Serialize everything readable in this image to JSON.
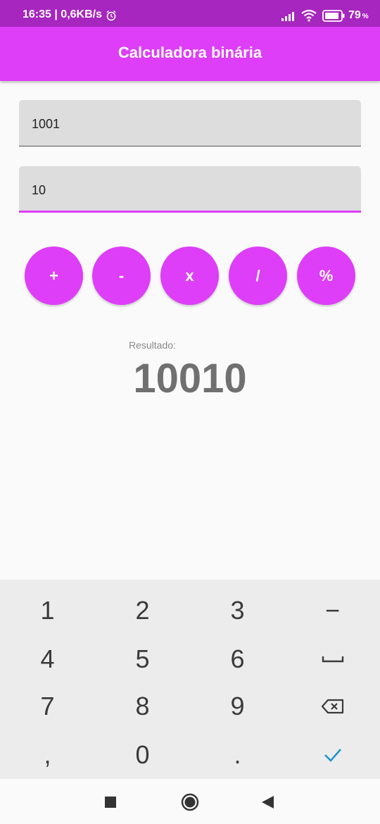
{
  "status_bar": {
    "time": "16:35 | 0,6KB/s",
    "battery_percent": "79",
    "battery_unit": "%",
    "icons": [
      "alarm-icon",
      "signal-icon",
      "wifi-icon",
      "battery-icon"
    ]
  },
  "app_bar": {
    "title": "Calculadora binária"
  },
  "inputs": {
    "first": {
      "value": "1001"
    },
    "second": {
      "value": "10"
    }
  },
  "operators": [
    "+",
    "-",
    "x",
    "/",
    "%"
  ],
  "result": {
    "label": "Resultado:",
    "value": "10010"
  },
  "keyboard": {
    "keys": [
      "1",
      "2",
      "3",
      "−",
      "4",
      "5",
      "6",
      "␣",
      "7",
      "8",
      "9",
      "⌫",
      ",",
      "0",
      ".",
      "✓"
    ],
    "icon_keys": [
      "space-icon",
      "backspace-icon",
      "checkmark-icon"
    ]
  },
  "nav_bar": {
    "icons": [
      "recent-apps-icon",
      "home-icon",
      "back-icon"
    ]
  },
  "colors": {
    "accent": "#de3ef8",
    "status_bar": "#a726bf",
    "check": "#2196c8"
  }
}
